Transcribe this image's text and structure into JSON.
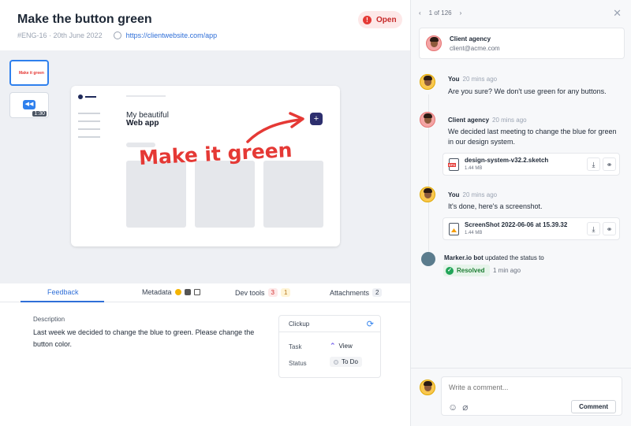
{
  "issue": {
    "title": "Make the button green",
    "id_date": "#ENG-16 · 20th June 2022",
    "url": "https://clientwebsite.com/app",
    "status": "Open"
  },
  "screenshot": {
    "heading_light": "My beautiful",
    "heading_bold": "Web app",
    "annotation": "Make it green",
    "thumb_label": "Make it green",
    "video_duration": "1:30"
  },
  "tabs": [
    {
      "label": "Feedback"
    },
    {
      "label": "Metadata"
    },
    {
      "label": "Dev tools",
      "errors": "3",
      "warnings": "1"
    },
    {
      "label": "Attachments",
      "count": "2"
    }
  ],
  "description": {
    "label": "Description",
    "text": "Last week we decided to change the blue to green. Please change the button color."
  },
  "clickup": {
    "title": "Clickup",
    "task_label": "Task",
    "task_value": "View",
    "status_label": "Status",
    "status_value": "To Do"
  },
  "sidebar": {
    "pager": "1 of 126",
    "reporter_name": "Client agency",
    "reporter_email": "client@acme.com",
    "comments": [
      {
        "author": "You",
        "time": "20 mins ago",
        "text": "Are you sure? We don't use green for any buttons."
      },
      {
        "author": "Client agency",
        "time": "20 mins ago",
        "text": "We decided last meeting to change the blue for green in our design system.",
        "attachment": {
          "name": "design-system-v32.2.sketch",
          "size": "1.44 MB"
        }
      },
      {
        "author": "You",
        "time": "20 mins ago",
        "text": "It's done, here's a screenshot.",
        "attachment": {
          "name": "ScreenShot 2022-06-06 at 15.39.32",
          "size": "1.44 MB"
        }
      }
    ],
    "bot": {
      "name": "Marker.io bot",
      "action": "updated the status to",
      "status": "Resolved",
      "time": "1 min ago"
    },
    "composer": {
      "placeholder": "Write a comment...",
      "button": "Comment"
    }
  },
  "colors": {
    "accent": "#2f6fd8",
    "open": "#e53935",
    "resolved": "#22a559",
    "annotation": "#e53935"
  }
}
